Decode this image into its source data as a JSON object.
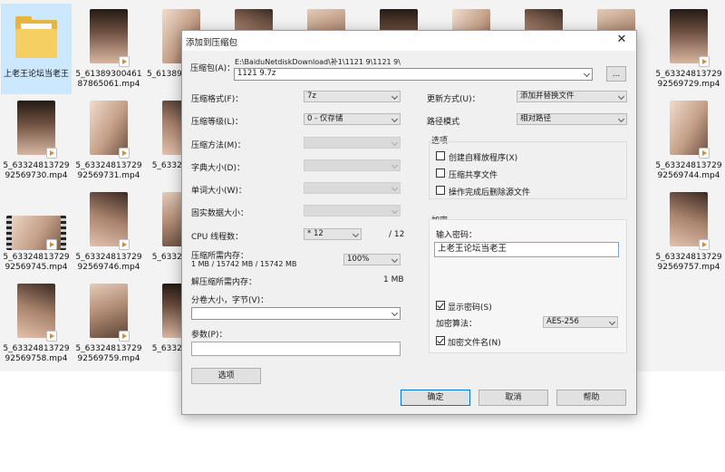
{
  "files": [
    {
      "name": "上老王论坛当老王",
      "kind": "folder",
      "selected": true
    },
    {
      "name": "5_61389300461 87865061.mp4",
      "kind": "video"
    },
    {
      "name": "5_61389 878650",
      "kind": "video"
    },
    {
      "name": "",
      "kind": "video"
    },
    {
      "name": "",
      "kind": "video"
    },
    {
      "name": "",
      "kind": "video"
    },
    {
      "name": "",
      "kind": "video"
    },
    {
      "name": "",
      "kind": "video"
    },
    {
      "name": "729 729",
      "kind": "video"
    },
    {
      "name": "5_63324813729 92569729.mp4",
      "kind": "video"
    },
    {
      "name": "5_63324813729 92569730.mp4",
      "kind": "video"
    },
    {
      "name": "5_63324813729 92569731.mp4",
      "kind": "video"
    },
    {
      "name": "5_6332 92569",
      "kind": "video"
    },
    {
      "name": "",
      "kind": "video"
    },
    {
      "name": "",
      "kind": "video"
    },
    {
      "name": "",
      "kind": "video"
    },
    {
      "name": "",
      "kind": "video"
    },
    {
      "name": "",
      "kind": "video"
    },
    {
      "name": "729 743",
      "kind": "video"
    },
    {
      "name": "5_63324813729 92569744.mp4",
      "kind": "video"
    },
    {
      "name": "5_63324813729 92569745.mp4",
      "kind": "video-wide"
    },
    {
      "name": "5_63324813729 92569746.mp4",
      "kind": "video"
    },
    {
      "name": "5_6332 92569",
      "kind": "video"
    },
    {
      "name": "",
      "kind": "video"
    },
    {
      "name": "",
      "kind": "video"
    },
    {
      "name": "",
      "kind": "video"
    },
    {
      "name": "",
      "kind": "video"
    },
    {
      "name": "",
      "kind": "video"
    },
    {
      "name": "729 756",
      "kind": "video"
    },
    {
      "name": "5_63324813729 92569757.mp4",
      "kind": "video"
    },
    {
      "name": "5_63324813729 92569758.mp4",
      "kind": "video"
    },
    {
      "name": "5_63324813729 92569759.mp4",
      "kind": "video"
    },
    {
      "name": "5_6332 92569",
      "kind": "video"
    }
  ],
  "dialog": {
    "title": "添加到压缩包",
    "close_glyph": "✕",
    "archive_label": "压缩包(A)：",
    "archive_path": "E:\\BaiduNetdiskDownload\\补1\\1121 9\\1121 9\\",
    "archive_name": "1121 9.7z",
    "browse_label": "...",
    "format_label": "压缩格式(F)：",
    "format_value": "7z",
    "level_label": "压缩等级(L)：",
    "level_value": "0 - 仅存储",
    "method_label": "压缩方法(M)：",
    "dict_label": "字典大小(D)：",
    "word_label": "单词大小(W)：",
    "solid_label": "固实数据大小：",
    "threads_label": "CPU 线程数：",
    "threads_value": "* 12",
    "threads_max": "/ 12",
    "mem_comp_label": "压缩所需内存：",
    "mem_comp_value": "1 MB / 15742 MB / 15742 MB",
    "mem_percent": "100%",
    "mem_decomp_label": "解压缩所需内存：",
    "mem_decomp_value": "1 MB",
    "split_label": "分卷大小，字节(V)：",
    "params_label": "参数(P)：",
    "options_button": "选项",
    "update_label": "更新方式(U)：",
    "update_value": "添加并替换文件",
    "path_label": "路径模式",
    "path_value": "相对路径",
    "options_group": "选项",
    "opt_sfx": "创建自释放程序(X)",
    "opt_shared": "压缩共享文件",
    "opt_delete": "操作完成后删除源文件",
    "encrypt_group": "加密",
    "password_label": "输入密码：",
    "password_value": "上老王论坛当老王",
    "show_password": "显示密码(S)",
    "encrypt_method_label": "加密算法：",
    "encrypt_method_value": "AES-256",
    "encrypt_names": "加密文件名(N)",
    "ok": "确定",
    "cancel": "取消",
    "help": "帮助"
  }
}
